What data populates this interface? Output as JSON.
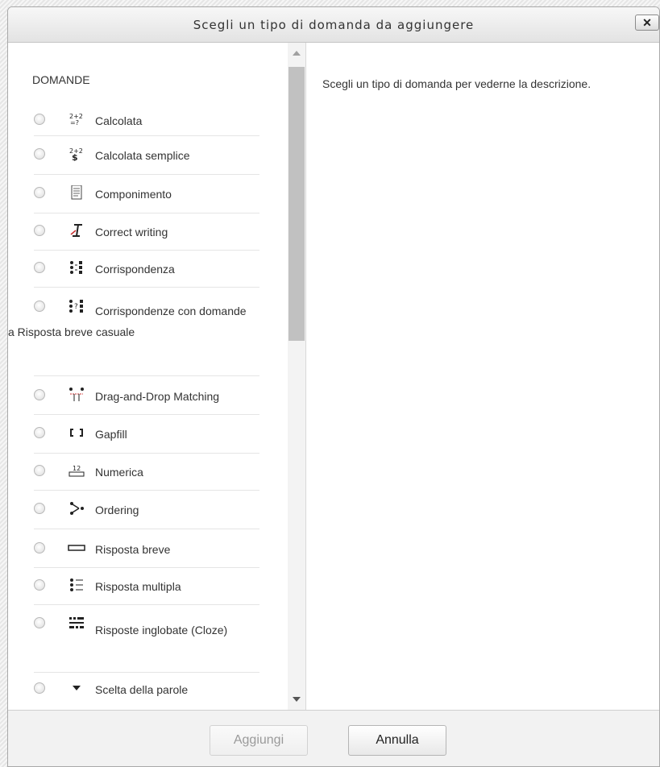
{
  "dialog": {
    "title": "Scegli un tipo di domanda da aggiungere",
    "close_label": "✕"
  },
  "list": {
    "section_label": "DOMANDE",
    "items": [
      {
        "label": "Calcolata",
        "icon": "calculated-icon",
        "glyph": "2+2 =?",
        "checked": false
      },
      {
        "label": "Calcolata semplice",
        "icon": "calculated-simple-icon",
        "glyph": "2+2",
        "checked": false
      },
      {
        "label": "Componimento",
        "icon": "essay-icon",
        "glyph": "▤",
        "checked": false
      },
      {
        "label": "Correct writing",
        "icon": "correct-writing-icon",
        "glyph": "I",
        "checked": false
      },
      {
        "label": "Corrispondenza",
        "icon": "matching-icon",
        "glyph": "⁝⁝",
        "checked": false
      },
      {
        "label": "Corrispondenze con domande a Risposta breve casuale",
        "icon": "random-matching-icon",
        "glyph": "⁝?⁝",
        "checked": false
      },
      {
        "label": "Drag-and-Drop Matching",
        "icon": "drag-drop-matching-icon",
        "glyph": "⊤",
        "checked": false
      },
      {
        "label": "Gapfill",
        "icon": "gapfill-icon",
        "glyph": "[ ]",
        "checked": false
      },
      {
        "label": "Numerica",
        "icon": "numerical-icon",
        "glyph": "12",
        "checked": false
      },
      {
        "label": "Ordering",
        "icon": "ordering-icon",
        "glyph": ">•",
        "checked": false
      },
      {
        "label": "Risposta breve",
        "icon": "short-answer-icon",
        "glyph": "▭",
        "checked": false
      },
      {
        "label": "Risposta multipla",
        "icon": "multiple-choice-icon",
        "glyph": "⁝☰",
        "checked": false
      },
      {
        "label": "Risposte inglobate (Cloze)",
        "icon": "cloze-icon",
        "glyph": "⁚☰",
        "checked": false
      },
      {
        "label": "Scelta della parole",
        "icon": "select-words-icon",
        "glyph": "▼",
        "checked": false
      }
    ]
  },
  "description": {
    "text": "Scegli un tipo di domanda per vederne la descrizione."
  },
  "footer": {
    "add_label": "Aggiungi",
    "cancel_label": "Annulla"
  }
}
